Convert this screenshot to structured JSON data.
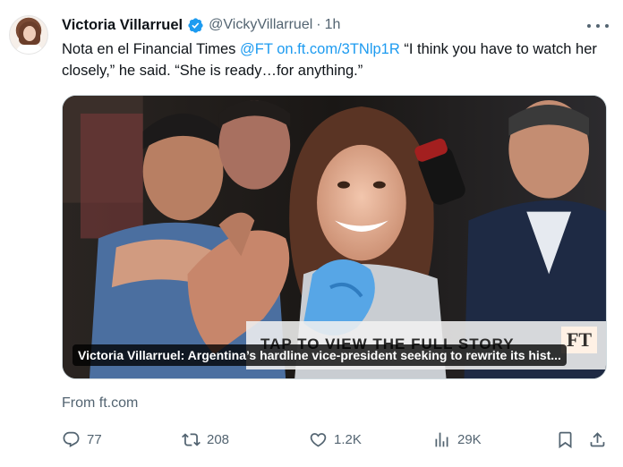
{
  "author": {
    "name": "Victoria Villarruel",
    "handle": "@VickyVillarruel",
    "separator": "·",
    "time": "1h"
  },
  "tweet": {
    "text_before": "Nota en el Financial Times ",
    "mention": "@FT",
    "space": " ",
    "link": "on.ft.com/3TNlp1R",
    "text_after": " “I think you have to watch her closely,” he said. “She is ready…for anything.”"
  },
  "card": {
    "banner_text": "TAP TO VIEW THE FULL STORY",
    "brand_logo": "FT",
    "caption": "Victoria Villarruel: Argentina’s hardline vice-president seeking to rewrite its hist...",
    "source": "From ft.com"
  },
  "actions": {
    "replies": "77",
    "reposts": "208",
    "likes": "1.2K",
    "views": "29K"
  },
  "icons": {
    "verified": "verified-badge-icon",
    "more": "more-options-icon",
    "reply": "reply-icon",
    "repost": "repost-icon",
    "like": "heart-icon",
    "views": "views-chart-icon",
    "bookmark": "bookmark-icon",
    "share": "share-icon"
  },
  "colors": {
    "link": "#1d9bf0",
    "verified": "#1d9bf0",
    "secondary_text": "#536471"
  }
}
